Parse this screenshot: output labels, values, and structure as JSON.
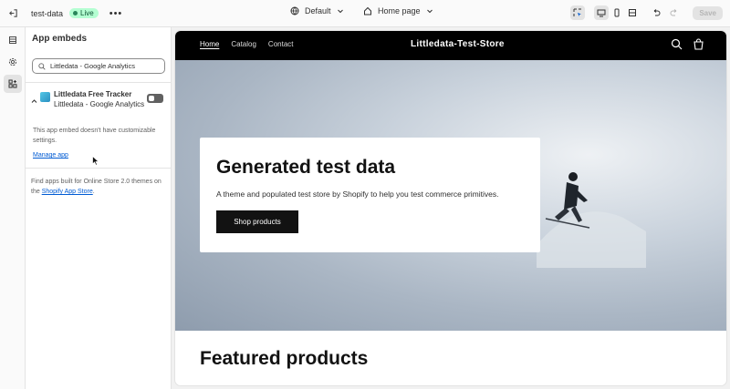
{
  "topbar": {
    "store_name": "test-data",
    "live_label": "Live",
    "more_label": "•••",
    "theme_label": "Default",
    "page_label": "Home page",
    "save_label": "Save"
  },
  "sidebar": {
    "title": "App embeds",
    "search_value": "Littledata - Google Analytics",
    "embed": {
      "name": "Littledata Free Tracker",
      "subtitle": "Littledata - Google Analytics",
      "enabled": false
    },
    "note": "This app embed doesn't have customizable settings.",
    "manage_link": "Manage app",
    "find_text": "Find apps built for Online Store 2.0 themes on the",
    "find_link": "Shopify App Store",
    "find_end": "."
  },
  "preview": {
    "nav": [
      "Home",
      "Catalog",
      "Contact"
    ],
    "store_title": "Littledata-Test-Store",
    "hero_title": "Generated test data",
    "hero_subtitle": "A theme and populated test store by Shopify to help you test commerce primitives.",
    "hero_button": "Shop products",
    "featured_title": "Featured products"
  },
  "colors": {
    "live_badge": "#b4fed2",
    "link": "#005bd3",
    "store_header": "#000000"
  }
}
